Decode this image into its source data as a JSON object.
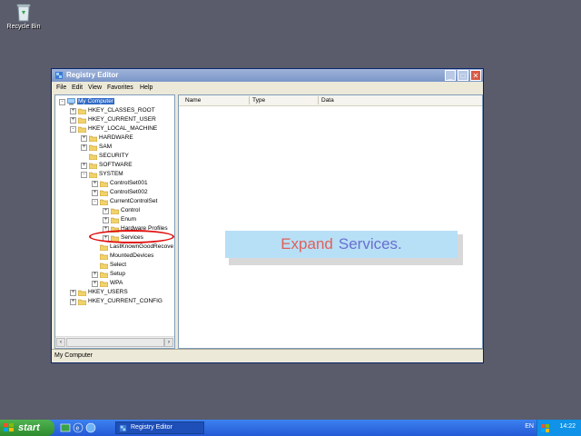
{
  "desktop": {
    "recycle_bin_label": "Recycle Bin"
  },
  "window": {
    "title": "Registry Editor",
    "menus": [
      "File",
      "Edit",
      "View",
      "Favorites",
      "Help"
    ],
    "status_text": "My Computer"
  },
  "tree": {
    "nodes": [
      {
        "label": "My Computer",
        "depth": 0,
        "expander": "-",
        "selected": true
      },
      {
        "label": "HKEY_CLASSES_ROOT",
        "depth": 1,
        "expander": "+"
      },
      {
        "label": "HKEY_CURRENT_USER",
        "depth": 1,
        "expander": "+"
      },
      {
        "label": "HKEY_LOCAL_MACHINE",
        "depth": 1,
        "expander": "-"
      },
      {
        "label": "HARDWARE",
        "depth": 2,
        "expander": "+"
      },
      {
        "label": "SAM",
        "depth": 2,
        "expander": "+"
      },
      {
        "label": "SECURITY",
        "depth": 2,
        "expander": ""
      },
      {
        "label": "SOFTWARE",
        "depth": 2,
        "expander": "+"
      },
      {
        "label": "SYSTEM",
        "depth": 2,
        "expander": "-"
      },
      {
        "label": "ControlSet001",
        "depth": 3,
        "expander": "+"
      },
      {
        "label": "ControlSet002",
        "depth": 3,
        "expander": "+"
      },
      {
        "label": "CurrentControlSet",
        "depth": 3,
        "expander": "-"
      },
      {
        "label": "Control",
        "depth": 4,
        "expander": "+"
      },
      {
        "label": "Enum",
        "depth": 4,
        "expander": "+"
      },
      {
        "label": "Hardware Profiles",
        "depth": 4,
        "expander": "+"
      },
      {
        "label": "Services",
        "depth": 4,
        "expander": "+"
      },
      {
        "label": "LastKnownGoodRecove",
        "depth": 3,
        "expander": ""
      },
      {
        "label": "MountedDevices",
        "depth": 3,
        "expander": ""
      },
      {
        "label": "Select",
        "depth": 3,
        "expander": ""
      },
      {
        "label": "Setup",
        "depth": 3,
        "expander": "+"
      },
      {
        "label": "WPA",
        "depth": 3,
        "expander": "+"
      },
      {
        "label": "HKEY_USERS",
        "depth": 1,
        "expander": "+"
      },
      {
        "label": "HKEY_CURRENT_CONFIG",
        "depth": 1,
        "expander": "+"
      }
    ]
  },
  "list": {
    "columns": [
      "Name",
      "Type",
      "Data"
    ]
  },
  "callout": {
    "word1": "Expand",
    "word2": "Services.",
    "word1_color": "#e0605a",
    "word2_color": "#6a6fd0"
  },
  "taskbar": {
    "start_label": "start",
    "task_label": "Registry Editor",
    "language": "EN",
    "clock": "14:22"
  },
  "colors": {
    "desktop": "#5a5c6b",
    "taskbar": "#2459d6",
    "start": "#2e8b2e",
    "highlight_ring": "#e01010"
  }
}
